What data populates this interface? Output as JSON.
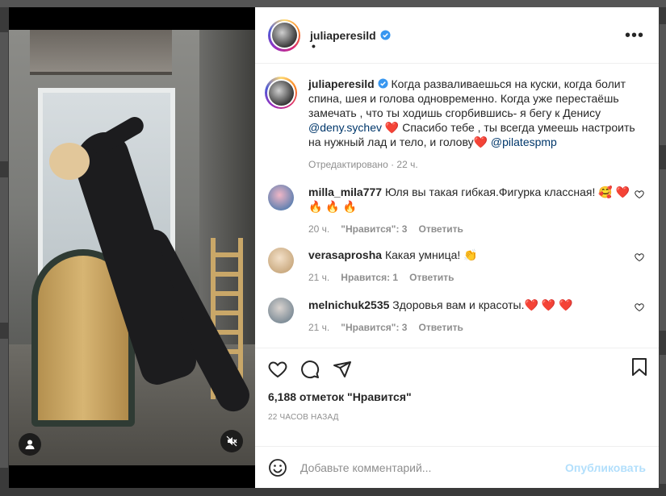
{
  "post": {
    "username": "juliaperesild",
    "subtitle": "•",
    "caption_text": "Когда разваливаешься на куски, когда болит спина, шея и голова одновременно. Когда уже перестаёшь замечать , что ты ходишь сгорбившись- я бегу к Денису",
    "caption_mention1": "@deny.sychev",
    "caption_heart1": "❤️",
    "caption_text2": "Спасибо тебе , ты всегда умеешь настроить на нужный лад и тело, и голову",
    "caption_heart2": "❤️",
    "caption_mention2": "@pilatespmp",
    "caption_meta": "Отредактировано · 22 ч.",
    "verified_color": "#3897f0"
  },
  "comments": [
    {
      "username": "milla_mila777",
      "text": "Юля вы такая гибкая.Фигурка классная!",
      "emoji": "🥰 ❤️",
      "emoji2": "🔥 🔥 🔥",
      "time": "20 ч.",
      "likes": "\"Нравится\": 3",
      "reply": "Ответить"
    },
    {
      "username": "verasaprosha",
      "text": "Какая умница!",
      "emoji": "👏",
      "time": "21 ч.",
      "likes": "Нравится: 1",
      "reply": "Ответить"
    },
    {
      "username": "melnichuk2535",
      "text": "Здоровья вам и красоты.",
      "emoji": "❤️ ❤️ ❤️",
      "time": "21 ч.",
      "likes": "\"Нравится\": 3",
      "reply": "Ответить"
    }
  ],
  "actions": {
    "likes_count": "6,188 отметок \"Нравится\"",
    "time_ago": "22 ЧАСОВ НАЗАД"
  },
  "add_comment": {
    "placeholder": "Добавьте комментарий...",
    "post_label": "Опубликовать"
  },
  "colors": {
    "link": "#00376b",
    "muted": "#8e8e8e",
    "post_disabled": "#b2dffc"
  }
}
